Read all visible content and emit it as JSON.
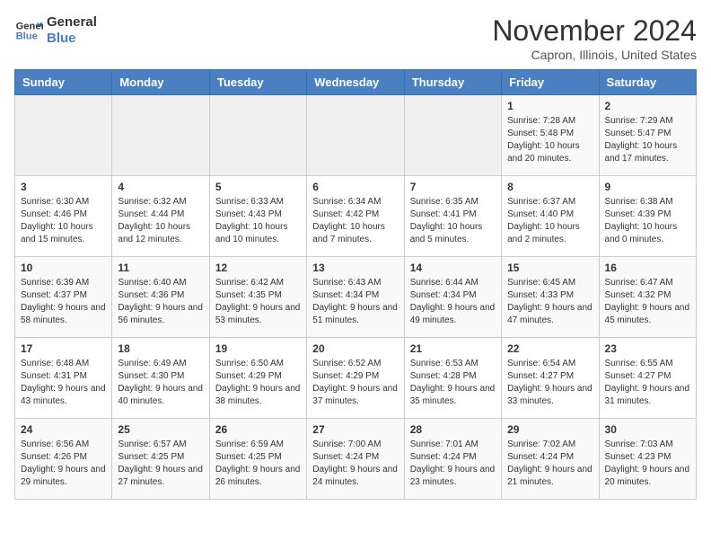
{
  "logo": {
    "line1": "General",
    "line2": "Blue"
  },
  "title": "November 2024",
  "subtitle": "Capron, Illinois, United States",
  "weekdays": [
    "Sunday",
    "Monday",
    "Tuesday",
    "Wednesday",
    "Thursday",
    "Friday",
    "Saturday"
  ],
  "weeks": [
    [
      {
        "day": "",
        "info": ""
      },
      {
        "day": "",
        "info": ""
      },
      {
        "day": "",
        "info": ""
      },
      {
        "day": "",
        "info": ""
      },
      {
        "day": "",
        "info": ""
      },
      {
        "day": "1",
        "info": "Sunrise: 7:28 AM\nSunset: 5:48 PM\nDaylight: 10 hours and 20 minutes."
      },
      {
        "day": "2",
        "info": "Sunrise: 7:29 AM\nSunset: 5:47 PM\nDaylight: 10 hours and 17 minutes."
      }
    ],
    [
      {
        "day": "3",
        "info": "Sunrise: 6:30 AM\nSunset: 4:46 PM\nDaylight: 10 hours and 15 minutes."
      },
      {
        "day": "4",
        "info": "Sunrise: 6:32 AM\nSunset: 4:44 PM\nDaylight: 10 hours and 12 minutes."
      },
      {
        "day": "5",
        "info": "Sunrise: 6:33 AM\nSunset: 4:43 PM\nDaylight: 10 hours and 10 minutes."
      },
      {
        "day": "6",
        "info": "Sunrise: 6:34 AM\nSunset: 4:42 PM\nDaylight: 10 hours and 7 minutes."
      },
      {
        "day": "7",
        "info": "Sunrise: 6:35 AM\nSunset: 4:41 PM\nDaylight: 10 hours and 5 minutes."
      },
      {
        "day": "8",
        "info": "Sunrise: 6:37 AM\nSunset: 4:40 PM\nDaylight: 10 hours and 2 minutes."
      },
      {
        "day": "9",
        "info": "Sunrise: 6:38 AM\nSunset: 4:39 PM\nDaylight: 10 hours and 0 minutes."
      }
    ],
    [
      {
        "day": "10",
        "info": "Sunrise: 6:39 AM\nSunset: 4:37 PM\nDaylight: 9 hours and 58 minutes."
      },
      {
        "day": "11",
        "info": "Sunrise: 6:40 AM\nSunset: 4:36 PM\nDaylight: 9 hours and 56 minutes."
      },
      {
        "day": "12",
        "info": "Sunrise: 6:42 AM\nSunset: 4:35 PM\nDaylight: 9 hours and 53 minutes."
      },
      {
        "day": "13",
        "info": "Sunrise: 6:43 AM\nSunset: 4:34 PM\nDaylight: 9 hours and 51 minutes."
      },
      {
        "day": "14",
        "info": "Sunrise: 6:44 AM\nSunset: 4:34 PM\nDaylight: 9 hours and 49 minutes."
      },
      {
        "day": "15",
        "info": "Sunrise: 6:45 AM\nSunset: 4:33 PM\nDaylight: 9 hours and 47 minutes."
      },
      {
        "day": "16",
        "info": "Sunrise: 6:47 AM\nSunset: 4:32 PM\nDaylight: 9 hours and 45 minutes."
      }
    ],
    [
      {
        "day": "17",
        "info": "Sunrise: 6:48 AM\nSunset: 4:31 PM\nDaylight: 9 hours and 43 minutes."
      },
      {
        "day": "18",
        "info": "Sunrise: 6:49 AM\nSunset: 4:30 PM\nDaylight: 9 hours and 40 minutes."
      },
      {
        "day": "19",
        "info": "Sunrise: 6:50 AM\nSunset: 4:29 PM\nDaylight: 9 hours and 38 minutes."
      },
      {
        "day": "20",
        "info": "Sunrise: 6:52 AM\nSunset: 4:29 PM\nDaylight: 9 hours and 37 minutes."
      },
      {
        "day": "21",
        "info": "Sunrise: 6:53 AM\nSunset: 4:28 PM\nDaylight: 9 hours and 35 minutes."
      },
      {
        "day": "22",
        "info": "Sunrise: 6:54 AM\nSunset: 4:27 PM\nDaylight: 9 hours and 33 minutes."
      },
      {
        "day": "23",
        "info": "Sunrise: 6:55 AM\nSunset: 4:27 PM\nDaylight: 9 hours and 31 minutes."
      }
    ],
    [
      {
        "day": "24",
        "info": "Sunrise: 6:56 AM\nSunset: 4:26 PM\nDaylight: 9 hours and 29 minutes."
      },
      {
        "day": "25",
        "info": "Sunrise: 6:57 AM\nSunset: 4:25 PM\nDaylight: 9 hours and 27 minutes."
      },
      {
        "day": "26",
        "info": "Sunrise: 6:59 AM\nSunset: 4:25 PM\nDaylight: 9 hours and 26 minutes."
      },
      {
        "day": "27",
        "info": "Sunrise: 7:00 AM\nSunset: 4:24 PM\nDaylight: 9 hours and 24 minutes."
      },
      {
        "day": "28",
        "info": "Sunrise: 7:01 AM\nSunset: 4:24 PM\nDaylight: 9 hours and 23 minutes."
      },
      {
        "day": "29",
        "info": "Sunrise: 7:02 AM\nSunset: 4:24 PM\nDaylight: 9 hours and 21 minutes."
      },
      {
        "day": "30",
        "info": "Sunrise: 7:03 AM\nSunset: 4:23 PM\nDaylight: 9 hours and 20 minutes."
      }
    ]
  ]
}
